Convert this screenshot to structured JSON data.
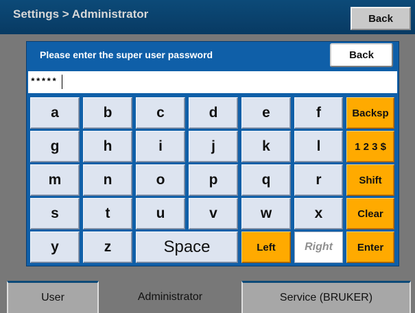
{
  "header": {
    "title": "Settings > Administrator",
    "back_label": "Back"
  },
  "dialog": {
    "prompt": "Please enter the super user password",
    "back_label": "Back",
    "password_value": "*****"
  },
  "keyboard": {
    "keys": [
      [
        "a",
        "b",
        "c",
        "d",
        "e",
        "f",
        "Backsp"
      ],
      [
        "g",
        "h",
        "i",
        "j",
        "k",
        "l",
        "1 2 3 $"
      ],
      [
        "m",
        "n",
        "o",
        "p",
        "q",
        "r",
        "Shift"
      ],
      [
        "s",
        "t",
        "u",
        "v",
        "w",
        "x",
        "Clear"
      ],
      [
        "y",
        "z",
        "Space",
        "Left",
        "Right",
        "Enter"
      ]
    ]
  },
  "tabs": [
    {
      "label": "User"
    },
    {
      "label": "Administrator"
    },
    {
      "label": "Service (BRUKER)"
    }
  ],
  "colors": {
    "header_bg": "#0c4a78",
    "dialog_bg": "#0f5fa8",
    "function_key": "#ffaa00",
    "letter_key": "#dde4f0",
    "background": "#787878"
  }
}
